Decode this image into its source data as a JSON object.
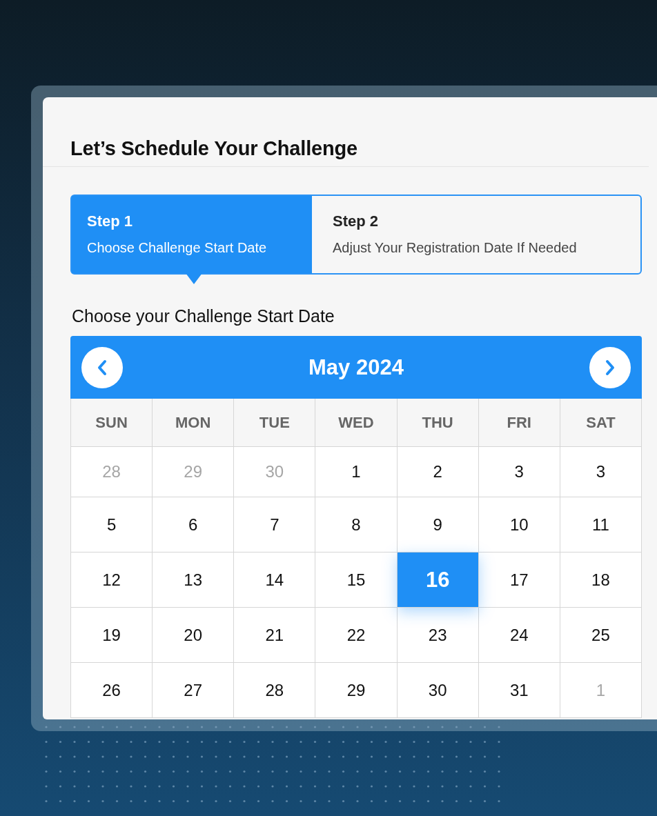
{
  "title": "Let’s Schedule Your Challenge",
  "steps": [
    {
      "label": "Step 1",
      "description": "Choose Challenge Start Date",
      "selected": true
    },
    {
      "label": "Step 2",
      "description": "Adjust Your Registration Date If Needed",
      "selected": false
    }
  ],
  "calendar": {
    "heading": "Choose your Challenge Start Date",
    "month": "May 2024",
    "weekdays": [
      "SUN",
      "MON",
      "TUE",
      "WED",
      "THU",
      "FRI",
      "SAT"
    ],
    "weeks": [
      [
        {
          "day": "28",
          "muted": true,
          "selected": false
        },
        {
          "day": "29",
          "muted": true,
          "selected": false
        },
        {
          "day": "30",
          "muted": true,
          "selected": false
        },
        {
          "day": "1",
          "muted": false,
          "selected": false
        },
        {
          "day": "2",
          "muted": false,
          "selected": false
        },
        {
          "day": "3",
          "muted": false,
          "selected": false
        },
        {
          "day": "3",
          "muted": false,
          "selected": false
        }
      ],
      [
        {
          "day": "5",
          "muted": false,
          "selected": false
        },
        {
          "day": "6",
          "muted": false,
          "selected": false
        },
        {
          "day": "7",
          "muted": false,
          "selected": false
        },
        {
          "day": "8",
          "muted": false,
          "selected": false
        },
        {
          "day": "9",
          "muted": false,
          "selected": false
        },
        {
          "day": "10",
          "muted": false,
          "selected": false
        },
        {
          "day": "11",
          "muted": false,
          "selected": false
        }
      ],
      [
        {
          "day": "12",
          "muted": false,
          "selected": false
        },
        {
          "day": "13",
          "muted": false,
          "selected": false
        },
        {
          "day": "14",
          "muted": false,
          "selected": false
        },
        {
          "day": "15",
          "muted": false,
          "selected": false
        },
        {
          "day": "16",
          "muted": false,
          "selected": true
        },
        {
          "day": "17",
          "muted": false,
          "selected": false
        },
        {
          "day": "18",
          "muted": false,
          "selected": false
        }
      ],
      [
        {
          "day": "19",
          "muted": false,
          "selected": false
        },
        {
          "day": "20",
          "muted": false,
          "selected": false
        },
        {
          "day": "21",
          "muted": false,
          "selected": false
        },
        {
          "day": "22",
          "muted": false,
          "selected": false
        },
        {
          "day": "23",
          "muted": false,
          "selected": false
        },
        {
          "day": "24",
          "muted": false,
          "selected": false
        },
        {
          "day": "25",
          "muted": false,
          "selected": false
        }
      ],
      [
        {
          "day": "26",
          "muted": false,
          "selected": false
        },
        {
          "day": "27",
          "muted": false,
          "selected": false
        },
        {
          "day": "28",
          "muted": false,
          "selected": false
        },
        {
          "day": "29",
          "muted": false,
          "selected": false
        },
        {
          "day": "30",
          "muted": false,
          "selected": false
        },
        {
          "day": "31",
          "muted": false,
          "selected": false
        },
        {
          "day": "1",
          "muted": true,
          "selected": false
        }
      ]
    ]
  }
}
